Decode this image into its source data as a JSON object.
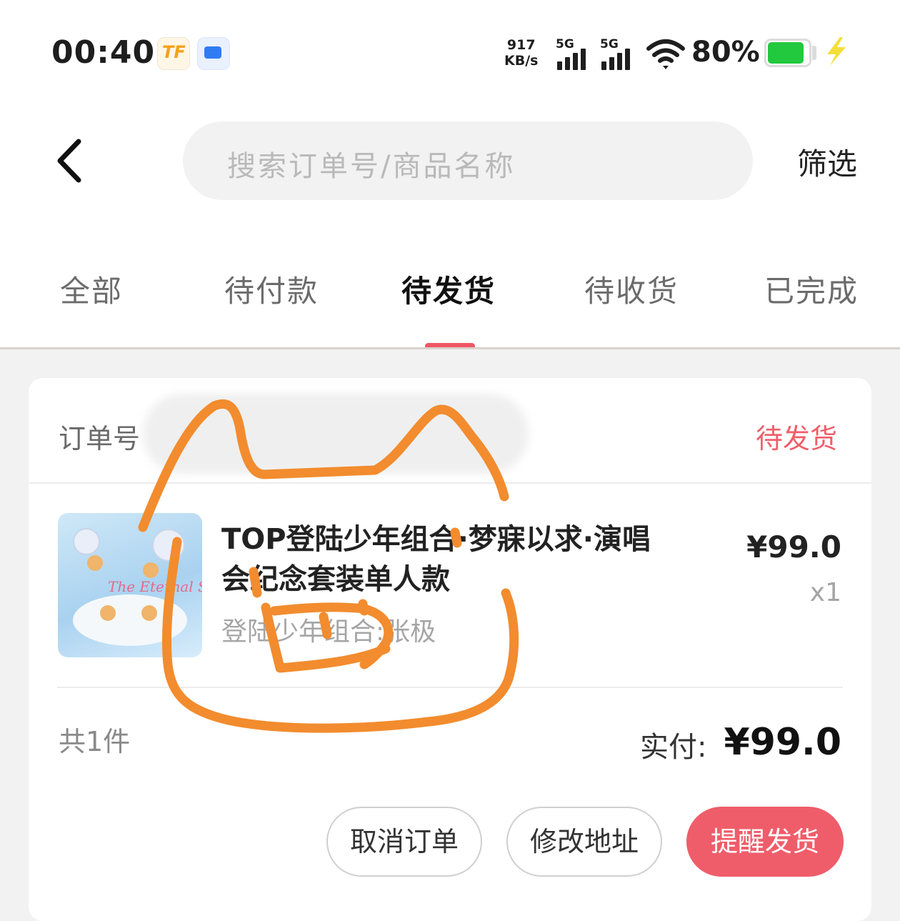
{
  "status_bar": {
    "time": "00:40",
    "net_speed_value": "917",
    "net_speed_unit": "KB/s",
    "signal1_label": "5G",
    "signal2_label": "5G",
    "battery_pct": "80%",
    "icons": [
      "tf-app-icon",
      "message-app-icon",
      "signal-icon",
      "wifi-icon",
      "battery-icon",
      "charging-icon"
    ]
  },
  "header": {
    "search_placeholder": "搜索订单号/商品名称",
    "filter_label": "筛选"
  },
  "tabs": [
    {
      "label": "全部"
    },
    {
      "label": "待付款"
    },
    {
      "label": "待发货"
    },
    {
      "label": "待收货"
    },
    {
      "label": "已完成"
    }
  ],
  "active_tab": "待发货",
  "order": {
    "order_no_label": "订单号",
    "status": "待发货",
    "product": {
      "title": "TOP登陆少年组合·梦寐以求·演唱会纪念套装单人款",
      "spec": "登陆少年组合:张极",
      "price": "¥99.0",
      "qty": "x1",
      "cover_text": "The Eternal Second"
    },
    "count": "共1件",
    "paid_label": "实付:",
    "paid_amount": "¥99.0",
    "actions": {
      "cancel": "取消订单",
      "edit_address": "修改地址",
      "remind": "提醒发货"
    }
  },
  "colors": {
    "accent": "#ef5d6a",
    "status_text": "#f05e6a",
    "doodle": "#f28c2e"
  }
}
